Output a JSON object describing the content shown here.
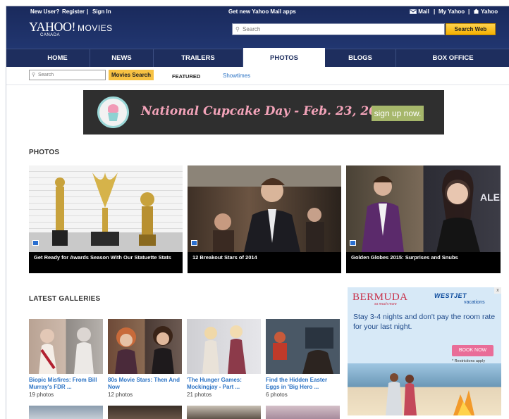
{
  "header": {
    "new_user": "New User?",
    "register": "Register",
    "sep1": "|",
    "sign_in": "Sign In",
    "mail_promo": "Get new Yahoo Mail apps",
    "mail": "Mail",
    "sep2": "|",
    "my_yahoo": "My Yahoo",
    "sep3": "|",
    "yahoo": "Yahoo",
    "logo": "YAHOO!",
    "logo_movies": "MOVIES",
    "logo_region": "CANADA",
    "search_placeholder": "Search",
    "search_web": "Search Web"
  },
  "nav": {
    "tabs": [
      {
        "label": "HOME"
      },
      {
        "label": "NEWS"
      },
      {
        "label": "TRAILERS"
      },
      {
        "label": "PHOTOS",
        "active": true
      },
      {
        "label": "BLOGS"
      },
      {
        "label": "BOX OFFICE"
      }
    ]
  },
  "subnav": {
    "search_placeholder": "Search",
    "movies_search": "Movies Search",
    "featured": "FEATURED",
    "showtimes": "Showtimes"
  },
  "banner": {
    "text": "National Cupcake Day - Feb. 23, 2015",
    "cta": "sign up now."
  },
  "photos": {
    "title": "PHOTOS",
    "items": [
      {
        "caption": "Get Ready for Awards Season With Our Statuette Stats"
      },
      {
        "caption": "12 Breakout Stars of 2014"
      },
      {
        "caption": "Golden Globes 2015: Surprises and Snubs"
      }
    ]
  },
  "galleries": {
    "title": "LATEST GALLERIES",
    "items": [
      {
        "title": "Biopic Misfires: From Bill Murray's FDR ...",
        "count": "19 photos"
      },
      {
        "title": "80s Movie Stars: Then And Now",
        "count": "12 photos"
      },
      {
        "title": "'The Hunger Games: Mockingjay - Part ...",
        "count": "21 photos"
      },
      {
        "title": "Find the Hidden Easter Eggs in 'Big Hero ...",
        "count": "6 photos"
      }
    ]
  },
  "ad": {
    "brand": "BERMUDA",
    "brand_tag": "so much more",
    "airline": "WESTJET",
    "airline_sub": "vacations",
    "text": "Stay 3-4 nights and don't pay the room rate for your last night.",
    "button": "BOOK NOW",
    "note": "* Restrictions apply",
    "close": "x"
  },
  "colors": {
    "header_bg": "#1a2a5c",
    "nav_bg": "#1e2e5e",
    "link_blue": "#2a72c4",
    "search_yellow": "#f7c243",
    "banner_bg": "#2f2f2f",
    "banner_pink": "#f3a3b9",
    "banner_cta": "#a6b76b"
  },
  "icons": {
    "mail": "mail-icon",
    "home": "home-icon",
    "search": "search-icon",
    "camera": "camera-icon"
  }
}
